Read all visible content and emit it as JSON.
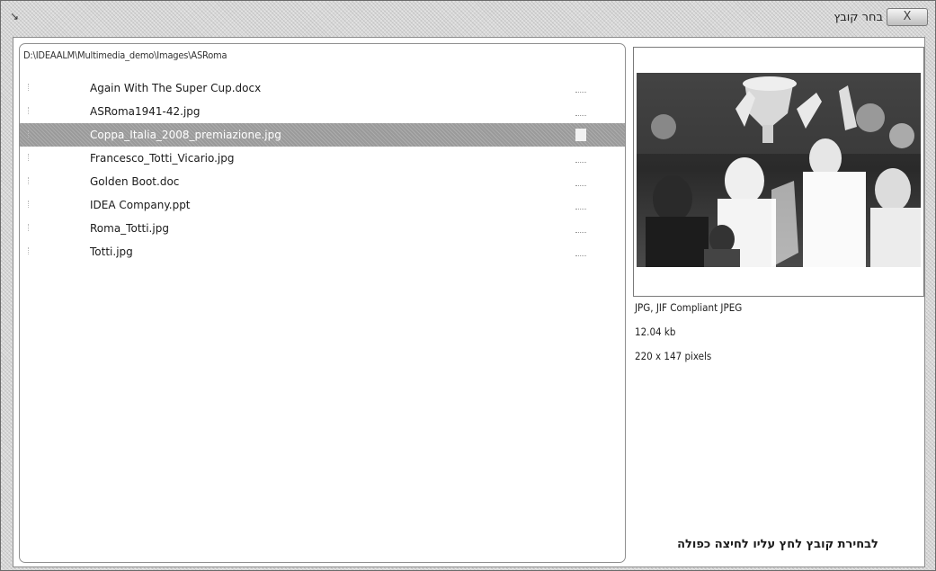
{
  "window": {
    "title": "בחר קובץ",
    "close_label": "X"
  },
  "file_browser": {
    "path": "D:\\IDEAALM\\Multimedia_demo\\Images\\ASRoma",
    "files": [
      {
        "name": "Again With The Super Cup.docx",
        "selected": false
      },
      {
        "name": "ASRoma1941-42.jpg",
        "selected": false
      },
      {
        "name": "Coppa_Italia_2008_premiazione.jpg",
        "selected": true
      },
      {
        "name": "Francesco_Totti_Vicario.jpg",
        "selected": false
      },
      {
        "name": "Golden Boot.doc",
        "selected": false
      },
      {
        "name": "IDEA Company.ppt",
        "selected": false
      },
      {
        "name": "Roma_Totti.jpg",
        "selected": false
      },
      {
        "name": "Totti.jpg",
        "selected": false
      }
    ]
  },
  "preview": {
    "format": "JPG, JIF Compliant JPEG",
    "size": "12.04 kb",
    "dimensions": "220 x 147 pixels",
    "hint": "לבחירת קובץ לחץ עליו לחיצה כפולה"
  },
  "colors": {
    "selection": "#9a9a9a",
    "frame": "#d9d9d9"
  }
}
